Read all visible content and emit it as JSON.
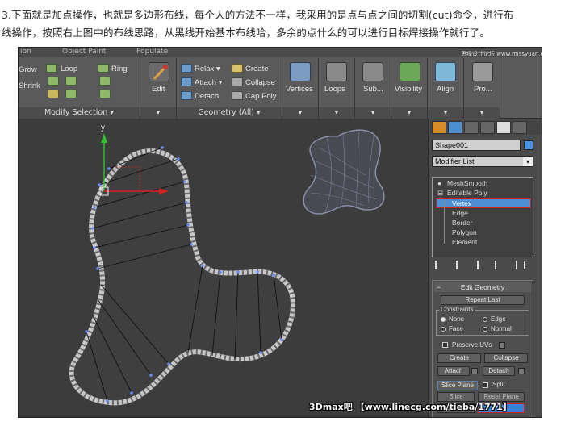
{
  "caption": {
    "line1": "3.下面就是加点操作，也就是多边形布线，每个人的方法不一样，我采用的是点与点之间的切割(cut)命令，进行布",
    "line2": "线操作，按照右上图中的布线思路，从黑线开始基本布线哈，多余的点什么的可以进行目标焊接操作就行了。"
  },
  "ribbon": {
    "top_labels": [
      "ion",
      "Object Paint",
      "Populate"
    ],
    "grow": "Grow",
    "shrink": "Shrink",
    "loop": "Loop",
    "ring": "Ring",
    "modify_selection": "Modify Selection ▾",
    "edit": "Edit",
    "relax": "Relax ▾",
    "attach": "Attach ▾",
    "detach": "Detach",
    "create": "Create",
    "collapse": "Collapse",
    "cap_poly": "Cap Poly",
    "geometry_all": "Geometry (All) ▾",
    "vertices": "Vertices",
    "loops": "Loops",
    "sub": "Sub...",
    "visibility": "Visibility",
    "align": "Align",
    "pro": "Pro...",
    "corner_watermark": "思缘设计论坛 www.missyuan.com"
  },
  "viewport": {
    "axis_y": "y",
    "axis_x": "x"
  },
  "command_panel": {
    "object_name": "Shape001",
    "modifier_list": "Modifier List",
    "stack": [
      "MeshSmooth",
      "Editable Poly",
      "Vertex",
      "Edge",
      "Border",
      "Polygon",
      "Element"
    ],
    "selected": "Vertex",
    "rollout_title": "Edit Geometry",
    "repeat_last": "Repeat Last",
    "constraints": "Constraints",
    "none": "None",
    "edge": "Edge",
    "face": "Face",
    "normal": "Normal",
    "preserve_uvs": "Preserve UVs",
    "create": "Create",
    "collapse": "Collapse",
    "attach": "Attach",
    "detach": "Detach",
    "slice_plane": "Slice Plane",
    "split": "Split",
    "slice": "Slice",
    "reset_plane": "Reset Plane",
    "quickslice": "QuickSlice",
    "cut": "Cut"
  },
  "watermark": "3Dmax吧 【www.linecg.com/tieba/1771】",
  "colors": {
    "viewport_bg": "#3c3c3c",
    "highlight_blue": "#4f8fd6",
    "selection_red": "#cc2222",
    "axis_green": "#2fbf2f",
    "axis_red": "#d82020"
  }
}
